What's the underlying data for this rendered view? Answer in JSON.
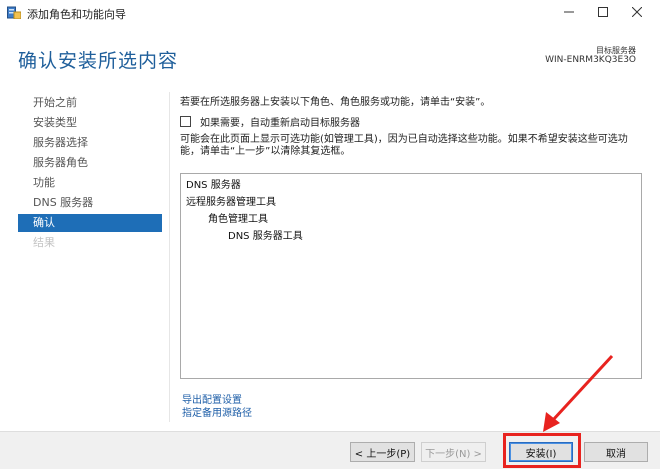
{
  "window": {
    "title": "添加角色和功能向导",
    "controls": {
      "minimize": "–",
      "maximize": "☐",
      "close": "✕"
    }
  },
  "header": {
    "page_title": "确认安装所选内容",
    "target_label": "目标服务器",
    "target_name": "WIN-ENRM3KQ3E3O"
  },
  "nav": {
    "items": [
      {
        "label": "开始之前",
        "state": "normal"
      },
      {
        "label": "安装类型",
        "state": "normal"
      },
      {
        "label": "服务器选择",
        "state": "normal"
      },
      {
        "label": "服务器角色",
        "state": "normal"
      },
      {
        "label": "功能",
        "state": "normal"
      },
      {
        "label": "DNS 服务器",
        "state": "normal"
      },
      {
        "label": "确认",
        "state": "active"
      },
      {
        "label": "结果",
        "state": "disabled"
      }
    ]
  },
  "main": {
    "intro": "若要在所选服务器上安装以下角色、角色服务或功能，请单击“安装”。",
    "restart_checkbox": {
      "label": "如果需要，自动重新启动目标服务器",
      "checked": false
    },
    "notice": "可能会在此页面上显示可选功能(如管理工具)，因为已自动选择这些功能。如果不希望安装这些可选功能，请单击“上一步”以清除其复选框。",
    "features": [
      {
        "label": "DNS 服务器",
        "level": 1
      },
      {
        "label": "远程服务器管理工具",
        "level": 1
      },
      {
        "label": "角色管理工具",
        "level": 2
      },
      {
        "label": "DNS 服务器工具",
        "level": 3
      }
    ],
    "links": {
      "export": "导出配置设置",
      "alt_source": "指定备用源路径"
    }
  },
  "footer": {
    "prev": "< 上一步(P)",
    "next": "下一步(N) >",
    "install": "安装(I)",
    "cancel": "取消"
  },
  "colors": {
    "accent": "#1e6eb7",
    "title": "#1f5f9b",
    "annotation": "#e8231f"
  }
}
